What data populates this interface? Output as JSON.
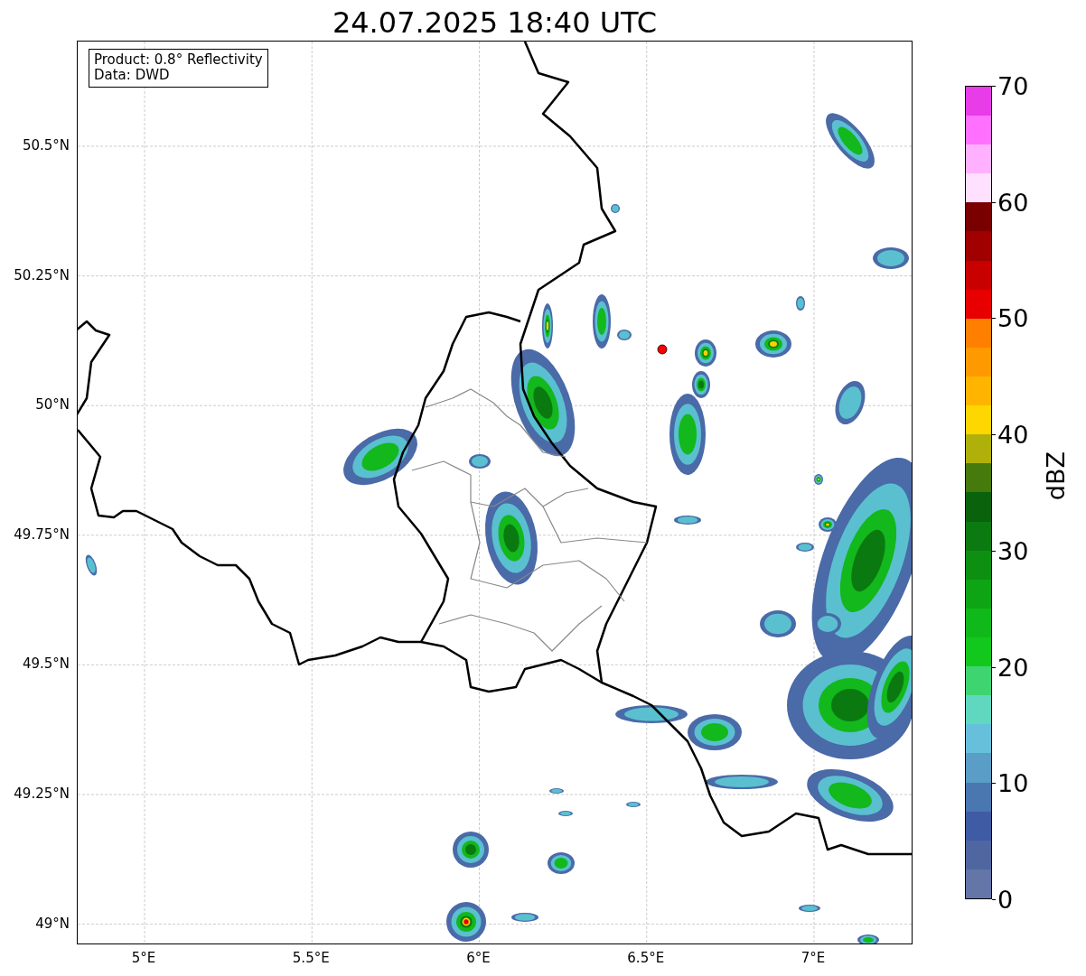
{
  "title": "24.07.2025 18:40 UTC",
  "legend": [
    "Product: 0.8° Reflectivity",
    "Data: DWD"
  ],
  "y_ticks": [
    "50.5°N",
    "50.25°N",
    "50°N",
    "49.75°N",
    "49.5°N",
    "49.25°N",
    "49°N"
  ],
  "x_ticks": [
    "5°E",
    "5.5°E",
    "6°E",
    "6.5°E",
    "7°E"
  ],
  "colorbar": {
    "label": "dBZ",
    "ticks": [
      "70",
      "60",
      "50",
      "40",
      "30",
      "20",
      "10",
      "0"
    ],
    "bands": [
      {
        "color": "#6475a8"
      },
      {
        "color": "#5066a0"
      },
      {
        "color": "#3f5ba3"
      },
      {
        "color": "#4a77b0"
      },
      {
        "color": "#5a9dc6"
      },
      {
        "color": "#66c0db"
      },
      {
        "color": "#60d8c0"
      },
      {
        "color": "#3ed571"
      },
      {
        "color": "#12c81c"
      },
      {
        "color": "#10b91a"
      },
      {
        "color": "#0ea515"
      },
      {
        "color": "#0d9012"
      },
      {
        "color": "#0b7a10"
      },
      {
        "color": "#0a620d"
      },
      {
        "color": "#467a0c"
      },
      {
        "color": "#b0b00a"
      },
      {
        "color": "#ffd700"
      },
      {
        "color": "#ffb400"
      },
      {
        "color": "#ff9900"
      },
      {
        "color": "#ff7f00"
      },
      {
        "color": "#e80000"
      },
      {
        "color": "#c80000"
      },
      {
        "color": "#a00000"
      },
      {
        "color": "#7a0000"
      },
      {
        "color": "#ffe0ff"
      },
      {
        "color": "#ffb0ff"
      },
      {
        "color": "#ff70ff"
      },
      {
        "color": "#e83ce8"
      }
    ]
  }
}
